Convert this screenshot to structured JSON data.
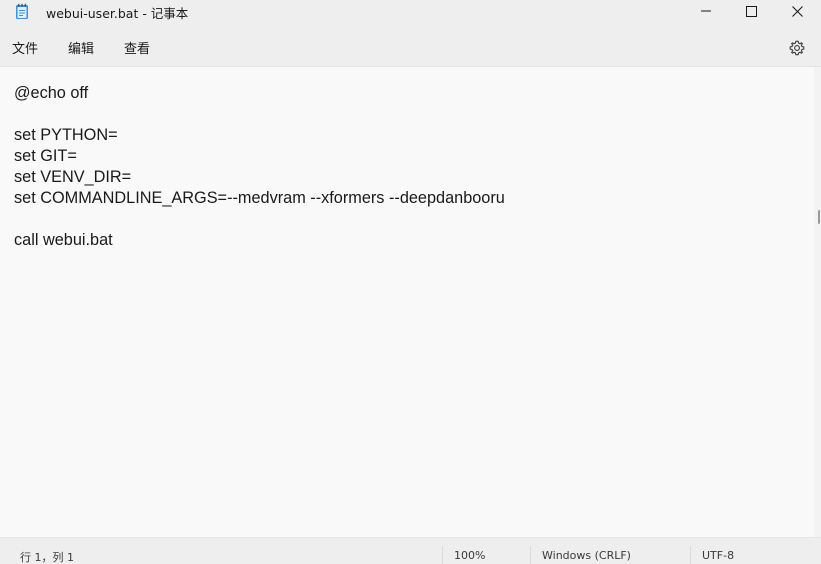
{
  "window": {
    "title": "webui-user.bat - 记事本",
    "icon": "notepad-icon"
  },
  "controls": {
    "minimize": "minimize-icon",
    "maximize": "maximize-icon",
    "close": "close-icon"
  },
  "menu": {
    "file": "文件",
    "edit": "编辑",
    "view": "查看",
    "settings": "gear-icon"
  },
  "editor": {
    "lines": [
      "@echo off",
      "",
      "set PYTHON=",
      "set GIT=",
      "set VENV_DIR=",
      "set COMMANDLINE_ARGS=--medvram --xformers --deepdanbooru",
      "",
      "call webui.bat"
    ]
  },
  "status": {
    "position": "行 1，列 1",
    "zoom": "100%",
    "line_ending": "Windows (CRLF)",
    "encoding": "UTF-8"
  }
}
